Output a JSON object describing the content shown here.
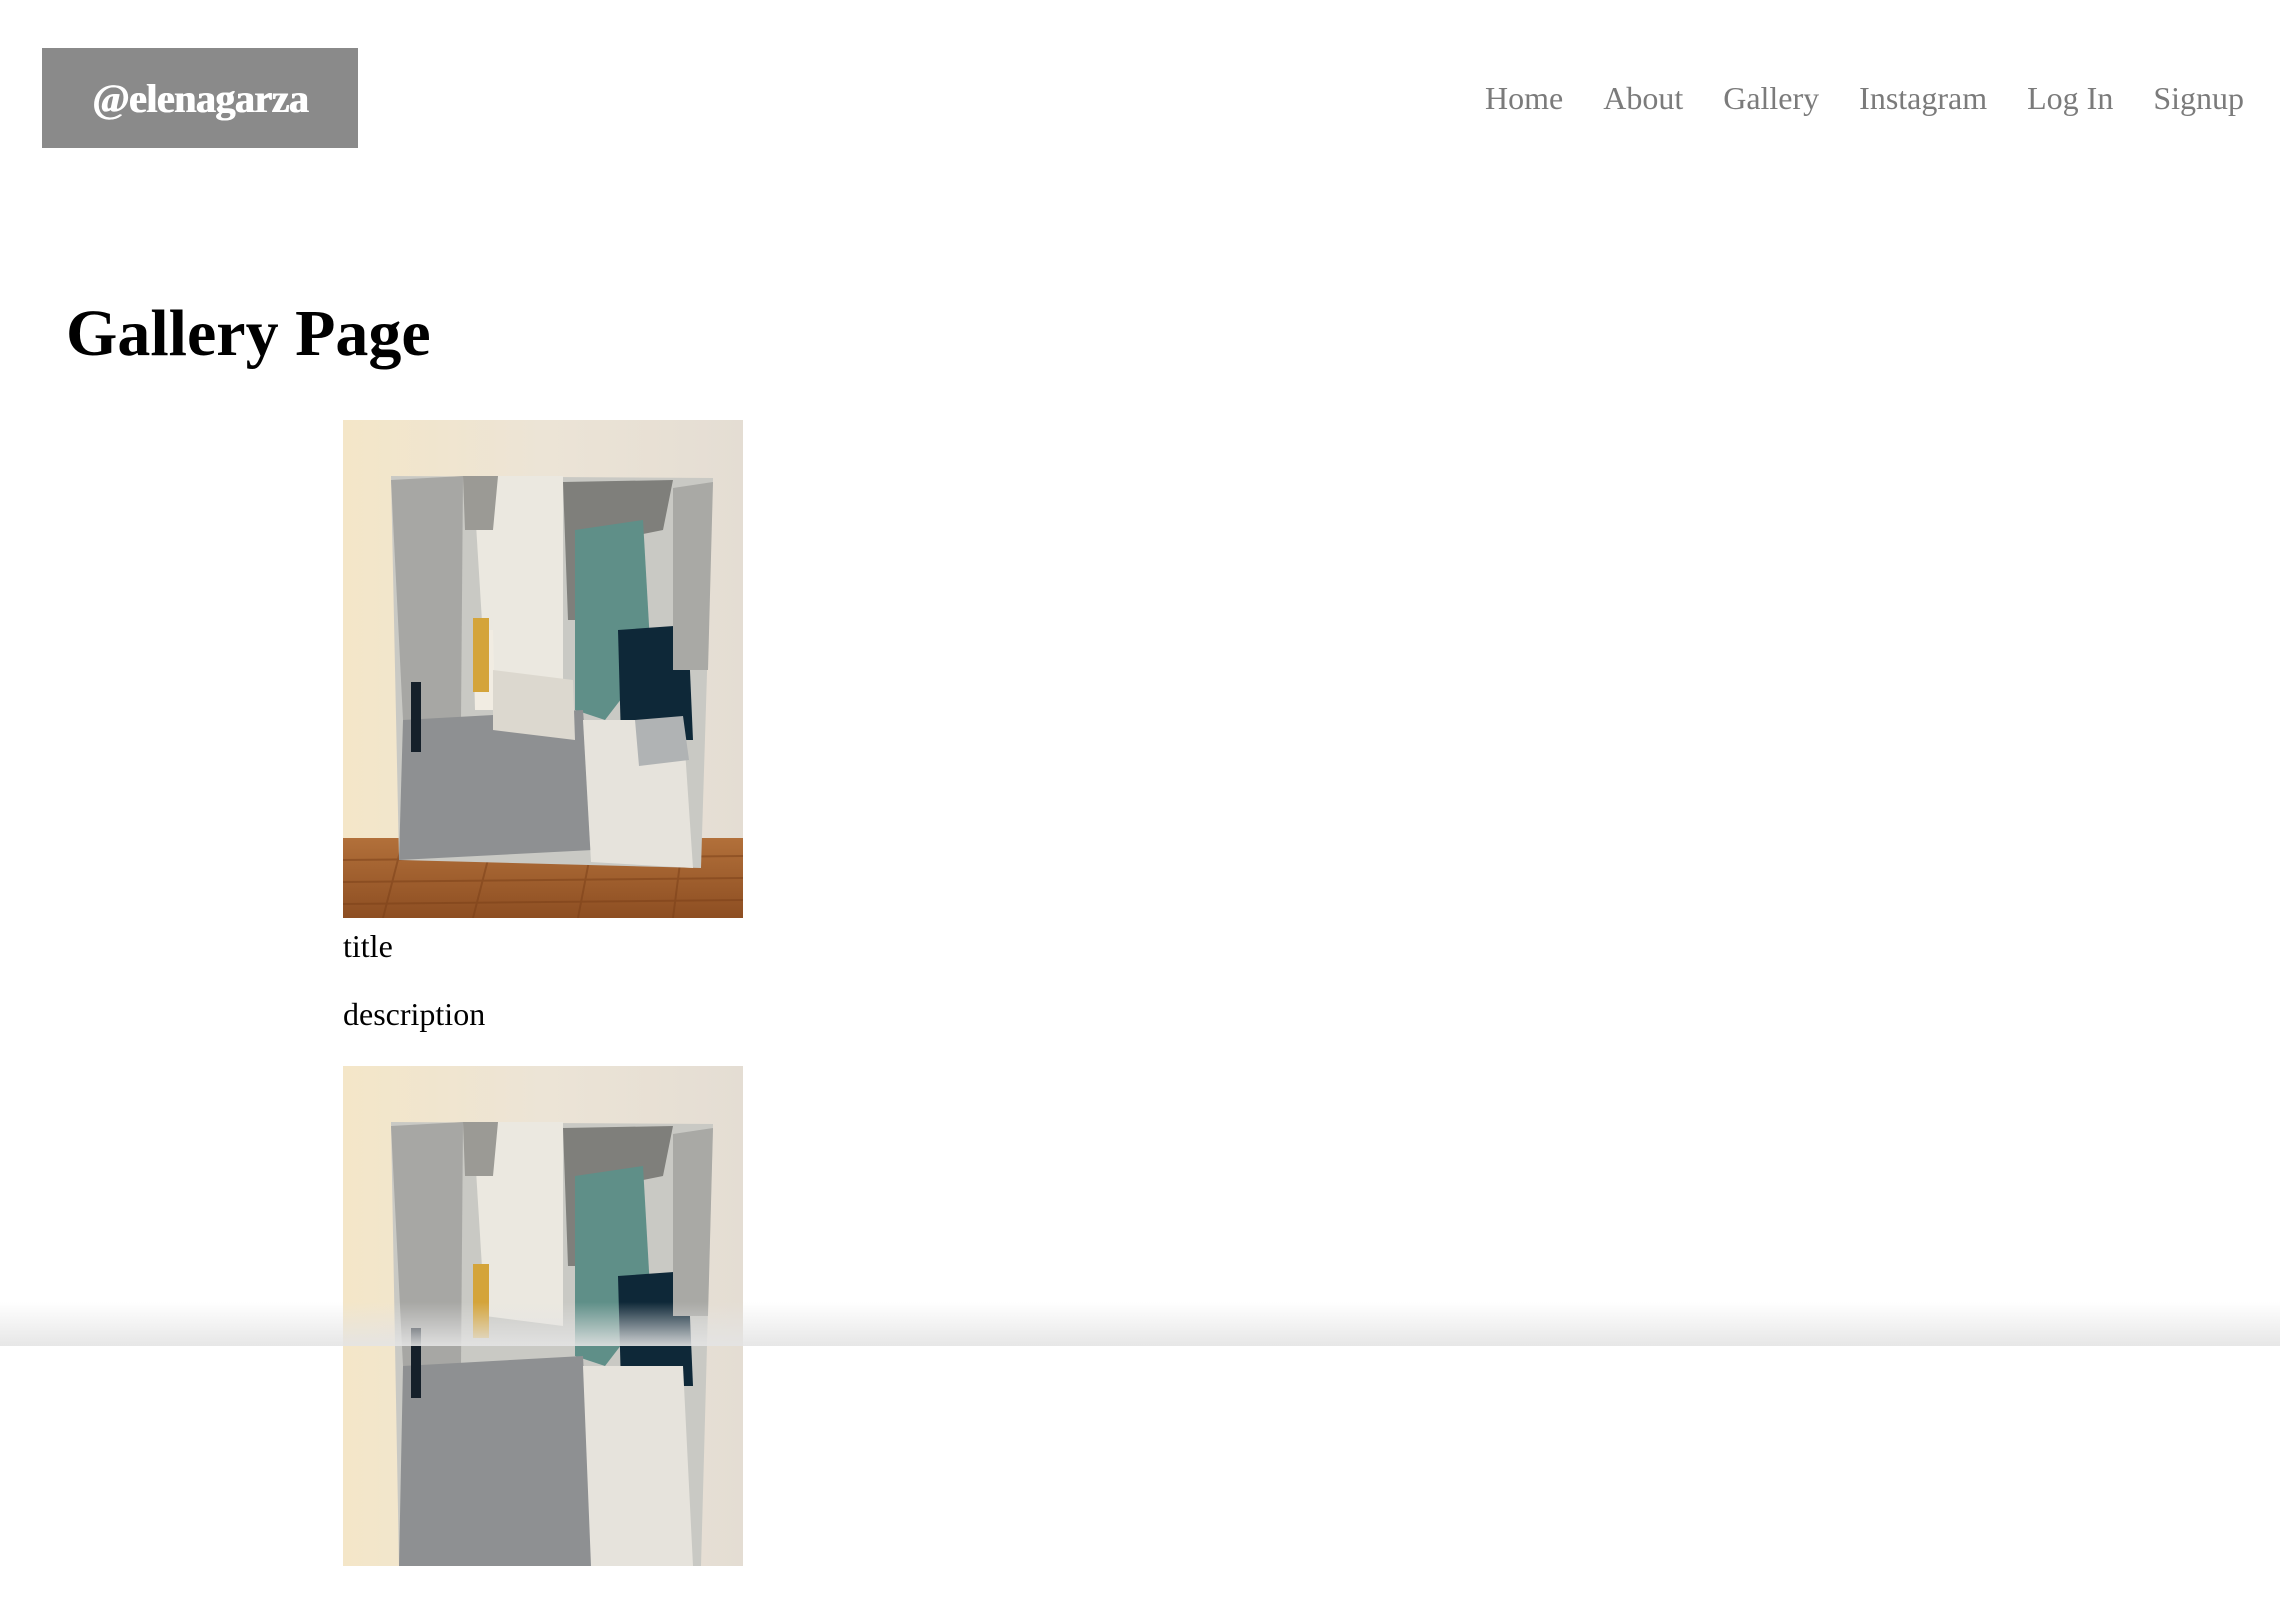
{
  "header": {
    "logo_text": "@elenagarza",
    "nav": [
      {
        "label": "Home"
      },
      {
        "label": "About"
      },
      {
        "label": "Gallery"
      },
      {
        "label": "Instagram"
      },
      {
        "label": "Log In"
      },
      {
        "label": "Signup"
      }
    ]
  },
  "main": {
    "title": "Gallery Page",
    "items": [
      {
        "title": "title",
        "description": "description"
      },
      {
        "title": "",
        "description": ""
      }
    ]
  },
  "colors": {
    "logo_bg": "#8a8a8a",
    "nav_text": "#7b7b7b"
  }
}
